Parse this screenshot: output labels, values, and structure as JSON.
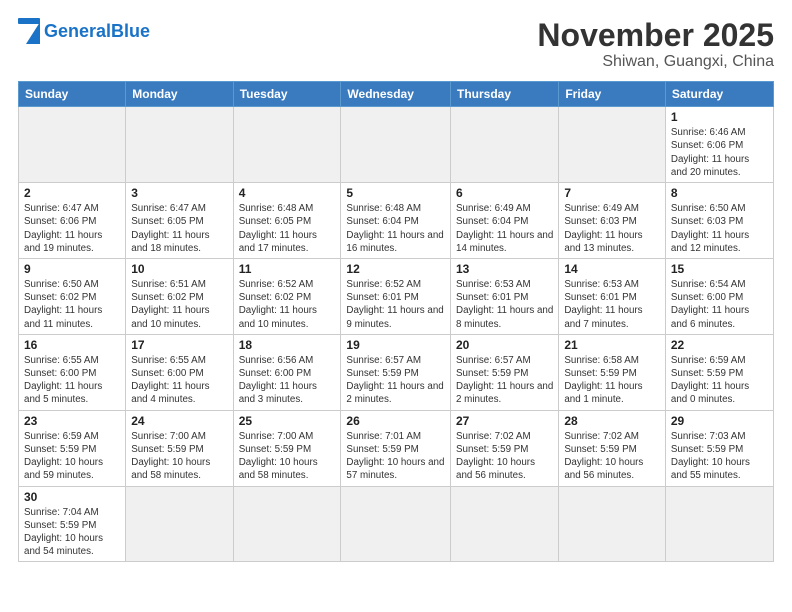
{
  "header": {
    "logo_general": "General",
    "logo_blue": "Blue",
    "title": "November 2025",
    "subtitle": "Shiwan, Guangxi, China"
  },
  "weekdays": [
    "Sunday",
    "Monday",
    "Tuesday",
    "Wednesday",
    "Thursday",
    "Friday",
    "Saturday"
  ],
  "weeks": [
    [
      {
        "day": "",
        "info": "",
        "empty": true
      },
      {
        "day": "",
        "info": "",
        "empty": true
      },
      {
        "day": "",
        "info": "",
        "empty": true
      },
      {
        "day": "",
        "info": "",
        "empty": true
      },
      {
        "day": "",
        "info": "",
        "empty": true
      },
      {
        "day": "",
        "info": "",
        "empty": true
      },
      {
        "day": "1",
        "info": "Sunrise: 6:46 AM\nSunset: 6:06 PM\nDaylight: 11 hours\nand 20 minutes."
      }
    ],
    [
      {
        "day": "2",
        "info": "Sunrise: 6:47 AM\nSunset: 6:06 PM\nDaylight: 11 hours\nand 19 minutes."
      },
      {
        "day": "3",
        "info": "Sunrise: 6:47 AM\nSunset: 6:05 PM\nDaylight: 11 hours\nand 18 minutes."
      },
      {
        "day": "4",
        "info": "Sunrise: 6:48 AM\nSunset: 6:05 PM\nDaylight: 11 hours\nand 17 minutes."
      },
      {
        "day": "5",
        "info": "Sunrise: 6:48 AM\nSunset: 6:04 PM\nDaylight: 11 hours\nand 16 minutes."
      },
      {
        "day": "6",
        "info": "Sunrise: 6:49 AM\nSunset: 6:04 PM\nDaylight: 11 hours\nand 14 minutes."
      },
      {
        "day": "7",
        "info": "Sunrise: 6:49 AM\nSunset: 6:03 PM\nDaylight: 11 hours\nand 13 minutes."
      },
      {
        "day": "8",
        "info": "Sunrise: 6:50 AM\nSunset: 6:03 PM\nDaylight: 11 hours\nand 12 minutes."
      }
    ],
    [
      {
        "day": "9",
        "info": "Sunrise: 6:50 AM\nSunset: 6:02 PM\nDaylight: 11 hours\nand 11 minutes."
      },
      {
        "day": "10",
        "info": "Sunrise: 6:51 AM\nSunset: 6:02 PM\nDaylight: 11 hours\nand 10 minutes."
      },
      {
        "day": "11",
        "info": "Sunrise: 6:52 AM\nSunset: 6:02 PM\nDaylight: 11 hours\nand 10 minutes."
      },
      {
        "day": "12",
        "info": "Sunrise: 6:52 AM\nSunset: 6:01 PM\nDaylight: 11 hours\nand 9 minutes."
      },
      {
        "day": "13",
        "info": "Sunrise: 6:53 AM\nSunset: 6:01 PM\nDaylight: 11 hours\nand 8 minutes."
      },
      {
        "day": "14",
        "info": "Sunrise: 6:53 AM\nSunset: 6:01 PM\nDaylight: 11 hours\nand 7 minutes."
      },
      {
        "day": "15",
        "info": "Sunrise: 6:54 AM\nSunset: 6:00 PM\nDaylight: 11 hours\nand 6 minutes."
      }
    ],
    [
      {
        "day": "16",
        "info": "Sunrise: 6:55 AM\nSunset: 6:00 PM\nDaylight: 11 hours\nand 5 minutes."
      },
      {
        "day": "17",
        "info": "Sunrise: 6:55 AM\nSunset: 6:00 PM\nDaylight: 11 hours\nand 4 minutes."
      },
      {
        "day": "18",
        "info": "Sunrise: 6:56 AM\nSunset: 6:00 PM\nDaylight: 11 hours\nand 3 minutes."
      },
      {
        "day": "19",
        "info": "Sunrise: 6:57 AM\nSunset: 5:59 PM\nDaylight: 11 hours\nand 2 minutes."
      },
      {
        "day": "20",
        "info": "Sunrise: 6:57 AM\nSunset: 5:59 PM\nDaylight: 11 hours\nand 2 minutes."
      },
      {
        "day": "21",
        "info": "Sunrise: 6:58 AM\nSunset: 5:59 PM\nDaylight: 11 hours\nand 1 minute."
      },
      {
        "day": "22",
        "info": "Sunrise: 6:59 AM\nSunset: 5:59 PM\nDaylight: 11 hours\nand 0 minutes."
      }
    ],
    [
      {
        "day": "23",
        "info": "Sunrise: 6:59 AM\nSunset: 5:59 PM\nDaylight: 10 hours\nand 59 minutes."
      },
      {
        "day": "24",
        "info": "Sunrise: 7:00 AM\nSunset: 5:59 PM\nDaylight: 10 hours\nand 58 minutes."
      },
      {
        "day": "25",
        "info": "Sunrise: 7:00 AM\nSunset: 5:59 PM\nDaylight: 10 hours\nand 58 minutes."
      },
      {
        "day": "26",
        "info": "Sunrise: 7:01 AM\nSunset: 5:59 PM\nDaylight: 10 hours\nand 57 minutes."
      },
      {
        "day": "27",
        "info": "Sunrise: 7:02 AM\nSunset: 5:59 PM\nDaylight: 10 hours\nand 56 minutes."
      },
      {
        "day": "28",
        "info": "Sunrise: 7:02 AM\nSunset: 5:59 PM\nDaylight: 10 hours\nand 56 minutes."
      },
      {
        "day": "29",
        "info": "Sunrise: 7:03 AM\nSunset: 5:59 PM\nDaylight: 10 hours\nand 55 minutes."
      }
    ],
    [
      {
        "day": "30",
        "info": "Sunrise: 7:04 AM\nSunset: 5:59 PM\nDaylight: 10 hours\nand 54 minutes."
      },
      {
        "day": "",
        "info": "",
        "empty": true
      },
      {
        "day": "",
        "info": "",
        "empty": true
      },
      {
        "day": "",
        "info": "",
        "empty": true
      },
      {
        "day": "",
        "info": "",
        "empty": true
      },
      {
        "day": "",
        "info": "",
        "empty": true
      },
      {
        "day": "",
        "info": "",
        "empty": true
      }
    ]
  ]
}
